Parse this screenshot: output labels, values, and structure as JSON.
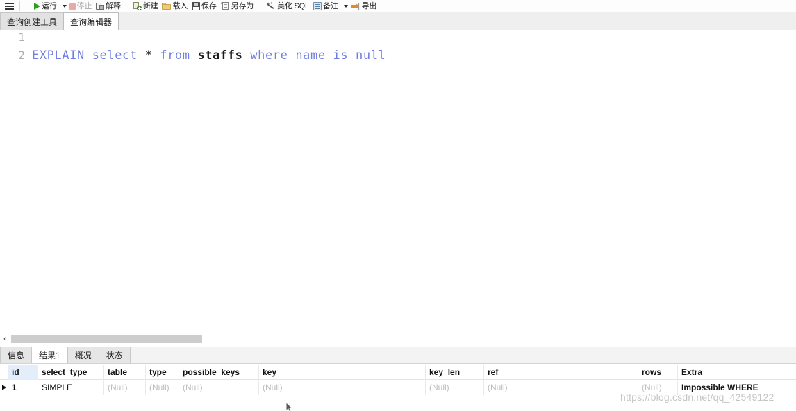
{
  "toolbar": {
    "menu_icon": "hamburger-icon",
    "items": [
      {
        "id": "run",
        "label": "运行",
        "icon": "play-icon",
        "disabled": false,
        "dropdown": true
      },
      {
        "id": "stop",
        "label": "停止",
        "icon": "stop-icon",
        "disabled": true,
        "dropdown": false
      },
      {
        "id": "explain",
        "label": "解释",
        "icon": "explain-icon",
        "disabled": false,
        "dropdown": false
      },
      {
        "id": "new",
        "label": "新建",
        "icon": "new-icon",
        "disabled": false,
        "dropdown": false
      },
      {
        "id": "load",
        "label": "载入",
        "icon": "folder-icon",
        "disabled": false,
        "dropdown": false
      },
      {
        "id": "save",
        "label": "保存",
        "icon": "save-icon",
        "disabled": false,
        "dropdown": false
      },
      {
        "id": "saveas",
        "label": "另存为",
        "icon": "save-as-icon",
        "disabled": false,
        "dropdown": false
      },
      {
        "id": "beautify",
        "label": "美化 SQL",
        "icon": "wand-icon",
        "disabled": false,
        "dropdown": false
      },
      {
        "id": "comment",
        "label": "备注",
        "icon": "note-icon",
        "disabled": false,
        "dropdown": true
      },
      {
        "id": "export",
        "label": "导出",
        "icon": "export-icon",
        "disabled": false,
        "dropdown": false
      }
    ]
  },
  "tabs": [
    {
      "id": "query-builder",
      "label": "查询创建工具",
      "active": false
    },
    {
      "id": "query-editor",
      "label": "查询编辑器",
      "active": true
    }
  ],
  "editor": {
    "lines": [
      {
        "number": "1",
        "tokens": []
      },
      {
        "number": "2",
        "tokens": [
          {
            "text": "EXPLAIN",
            "kind": "kw"
          },
          {
            "text": " ",
            "kind": "op"
          },
          {
            "text": "select",
            "kind": "kw"
          },
          {
            "text": " ",
            "kind": "op"
          },
          {
            "text": "*",
            "kind": "op"
          },
          {
            "text": " ",
            "kind": "op"
          },
          {
            "text": "from",
            "kind": "kw"
          },
          {
            "text": " ",
            "kind": "op"
          },
          {
            "text": "staffs",
            "kind": "ident"
          },
          {
            "text": " ",
            "kind": "op"
          },
          {
            "text": "where",
            "kind": "kw"
          },
          {
            "text": " ",
            "kind": "op"
          },
          {
            "text": "name",
            "kind": "kw"
          },
          {
            "text": " ",
            "kind": "op"
          },
          {
            "text": "is",
            "kind": "kw"
          },
          {
            "text": " ",
            "kind": "op"
          },
          {
            "text": "null",
            "kind": "kw"
          }
        ]
      }
    ],
    "full_text": "EXPLAIN select * from staffs where name is null"
  },
  "scrollbar": {
    "left_arrow": "‹"
  },
  "result_tabs": [
    {
      "id": "info",
      "label": "信息",
      "active": false
    },
    {
      "id": "result1",
      "label": "结果1",
      "active": true
    },
    {
      "id": "profile",
      "label": "概况",
      "active": false
    },
    {
      "id": "status",
      "label": "状态",
      "active": false
    }
  ],
  "result_grid": {
    "columns": [
      {
        "key": "id",
        "label": "id",
        "cls": "c-id",
        "selected": true
      },
      {
        "key": "select_type",
        "label": "select_type",
        "cls": "c-seltype",
        "selected": false
      },
      {
        "key": "table",
        "label": "table",
        "cls": "c-table",
        "selected": false
      },
      {
        "key": "type",
        "label": "type",
        "cls": "c-type",
        "selected": false
      },
      {
        "key": "possible_keys",
        "label": "possible_keys",
        "cls": "c-poss",
        "selected": false
      },
      {
        "key": "key",
        "label": "key",
        "cls": "c-key",
        "selected": false
      },
      {
        "key": "key_len",
        "label": "key_len",
        "cls": "c-keylen",
        "selected": false
      },
      {
        "key": "ref",
        "label": "ref",
        "cls": "c-ref",
        "selected": false
      },
      {
        "key": "rows",
        "label": "rows",
        "cls": "c-rows",
        "selected": false
      },
      {
        "key": "Extra",
        "label": "Extra",
        "cls": "c-extra",
        "selected": false
      }
    ],
    "rows": [
      {
        "selected": true,
        "cells": [
          {
            "value": "1",
            "null": false,
            "strong": true
          },
          {
            "value": "SIMPLE",
            "null": false,
            "strong": false
          },
          {
            "value": "(Null)",
            "null": true,
            "strong": false
          },
          {
            "value": "(Null)",
            "null": true,
            "strong": false
          },
          {
            "value": "(Null)",
            "null": true,
            "strong": false
          },
          {
            "value": "(Null)",
            "null": true,
            "strong": false
          },
          {
            "value": "(Null)",
            "null": true,
            "strong": false
          },
          {
            "value": "(Null)",
            "null": true,
            "strong": false
          },
          {
            "value": "(Null)",
            "null": true,
            "strong": false
          },
          {
            "value": "Impossible WHERE",
            "null": false,
            "strong": true
          }
        ]
      }
    ]
  },
  "watermark": {
    "text": "https://blog.csdn.net/qq_42549122"
  },
  "colors": {
    "keyword": "#6f7ee0",
    "identifier": "#1b1b1b",
    "line_number": "#adadad",
    "selected_header": "#e4eefb",
    "null_text": "#bdbdbd",
    "run_icon": "#2f9e1f",
    "export_icon": "#e08a2e"
  }
}
